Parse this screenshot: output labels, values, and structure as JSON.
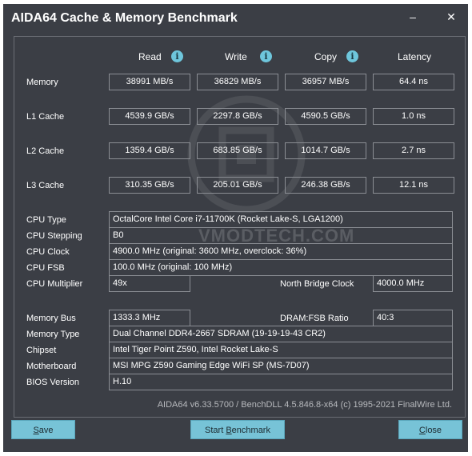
{
  "window": {
    "title": "AIDA64 Cache & Memory Benchmark",
    "minimize_glyph": "–",
    "close_glyph": "✕"
  },
  "columns": {
    "read": "Read",
    "write": "Write",
    "copy": "Copy",
    "latency": "Latency"
  },
  "benchmarks": [
    {
      "label": "Memory",
      "read": "38991 MB/s",
      "write": "36829 MB/s",
      "copy": "36957 MB/s",
      "latency": "64.4 ns"
    },
    {
      "label": "L1 Cache",
      "read": "4539.9 GB/s",
      "write": "2297.8 GB/s",
      "copy": "4590.5 GB/s",
      "latency": "1.0 ns"
    },
    {
      "label": "L2 Cache",
      "read": "1359.4 GB/s",
      "write": "683.85 GB/s",
      "copy": "1014.7 GB/s",
      "latency": "2.7 ns"
    },
    {
      "label": "L3 Cache",
      "read": "310.35 GB/s",
      "write": "205.01 GB/s",
      "copy": "246.38 GB/s",
      "latency": "12.1 ns"
    }
  ],
  "cpu": {
    "type_label": "CPU Type",
    "type": "OctalCore Intel Core i7-11700K  (Rocket Lake-S, LGA1200)",
    "stepping_label": "CPU Stepping",
    "stepping": "B0",
    "clock_label": "CPU Clock",
    "clock": "4900.0 MHz  (original: 3600 MHz, overclock: 36%)",
    "fsb_label": "CPU FSB",
    "fsb": "100.0 MHz  (original: 100 MHz)",
    "multiplier_label": "CPU Multiplier",
    "multiplier": "49x",
    "nb_clock_label": "North Bridge Clock",
    "nb_clock": "4000.0 MHz"
  },
  "system": {
    "membus_label": "Memory Bus",
    "membus": "1333.3 MHz",
    "dram_ratio_label": "DRAM:FSB Ratio",
    "dram_ratio": "40:3",
    "memtype_label": "Memory Type",
    "memtype": "Dual Channel DDR4-2667 SDRAM  (19-19-19-43 CR2)",
    "chipset_label": "Chipset",
    "chipset": "Intel Tiger Point Z590, Intel Rocket Lake-S",
    "motherboard_label": "Motherboard",
    "motherboard": "MSI MPG Z590 Gaming Edge WiFi SP (MS-7D07)",
    "bios_label": "BIOS Version",
    "bios": "H.10"
  },
  "footer": "AIDA64 v6.33.5700 / BenchDLL 4.5.846.8-x64  (c) 1995-2021 FinalWire Ltd.",
  "watermark": "VMODTECH.COM",
  "buttons": {
    "save_u": "S",
    "save_rest": "ave",
    "start_a": "Start ",
    "start_u": "B",
    "start_b": "enchmark",
    "close_u": "C",
    "close_rest": "lose"
  },
  "colors": {
    "background": "#3b3e45",
    "button": "#77c3d7",
    "info_icon": "#6ec6dc"
  }
}
